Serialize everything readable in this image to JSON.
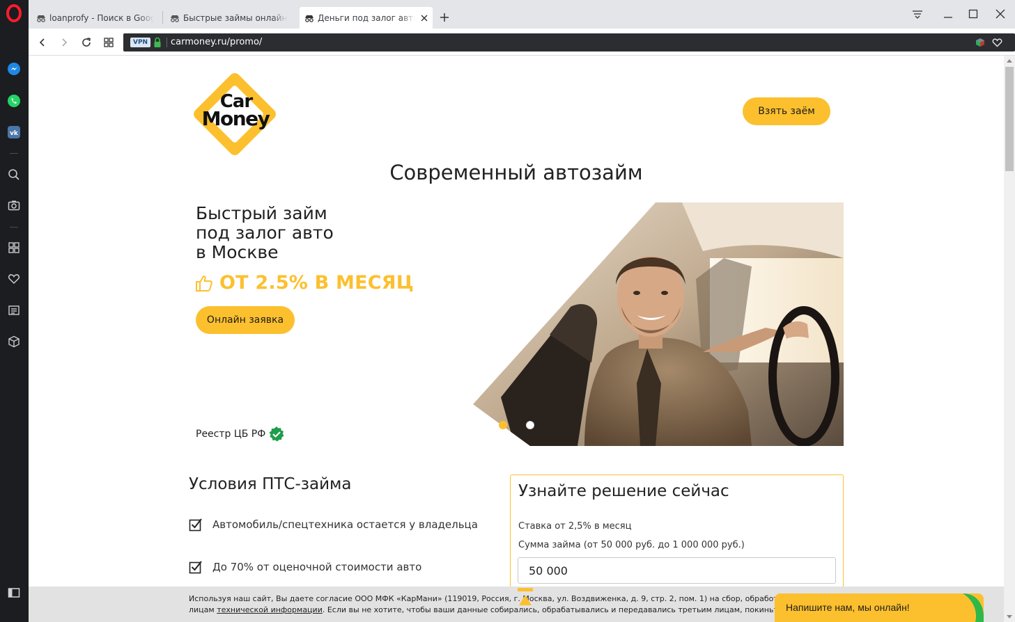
{
  "browser": {
    "tabs": [
      {
        "title": "loanprofy - Поиск в Google",
        "active": false
      },
      {
        "title": "Быстрые займы онлайн на карту",
        "active": false
      },
      {
        "title": "Деньги под залог автомобиля",
        "active": true
      }
    ],
    "address": {
      "vpn_label": "VPN",
      "url": "carmoney.ru/promo/"
    }
  },
  "site": {
    "logo_text": [
      "Car",
      "Money"
    ],
    "header_cta": "Взять заём",
    "hero_title": "Современный автозайм",
    "headline_lines": [
      "Быстрый займ",
      "под залог авто",
      "в Москве"
    ],
    "rate": "ОТ 2.5% В МЕСЯЦ",
    "online_cta": "Онлайн заявка",
    "registry": "Реестр ЦБ РФ"
  },
  "conditions": {
    "title": "Условия ПТС-займа",
    "items": [
      "Автомобиль/спецтехника остается у владельца",
      "До 70% от оценочной стоимости авто"
    ]
  },
  "form": {
    "title": "Узнайте решение сейчас",
    "rate_text": "Ставка от 2,5% в месяц",
    "sum_label": "Сумма займа (от 50 000 руб. до 1 000 000 руб.)",
    "sum_value": "50 000"
  },
  "cookie": {
    "line1": "Используя наш сайт, Вы даете согласие ООО МФК «КарМани» (119019, Россия, г. Москва, ул. Воздвиженка, д. 9, стр. 2, пом. 1) на сбор, обработку и передачу",
    "line2_before": "лицам ",
    "line2_link": "технической информации",
    "line2_after": ". Если вы не хотите, чтобы ваши данные собирались, обрабатывались и передавались третьим лицам, покиньте сайт."
  },
  "chat": {
    "label": "Напишите нам, мы онлайн!"
  },
  "colors": {
    "brand_yellow": "#fcc02e",
    "sidebar_dark": "#1b1d20",
    "tabbar": "#e3e5e9"
  }
}
